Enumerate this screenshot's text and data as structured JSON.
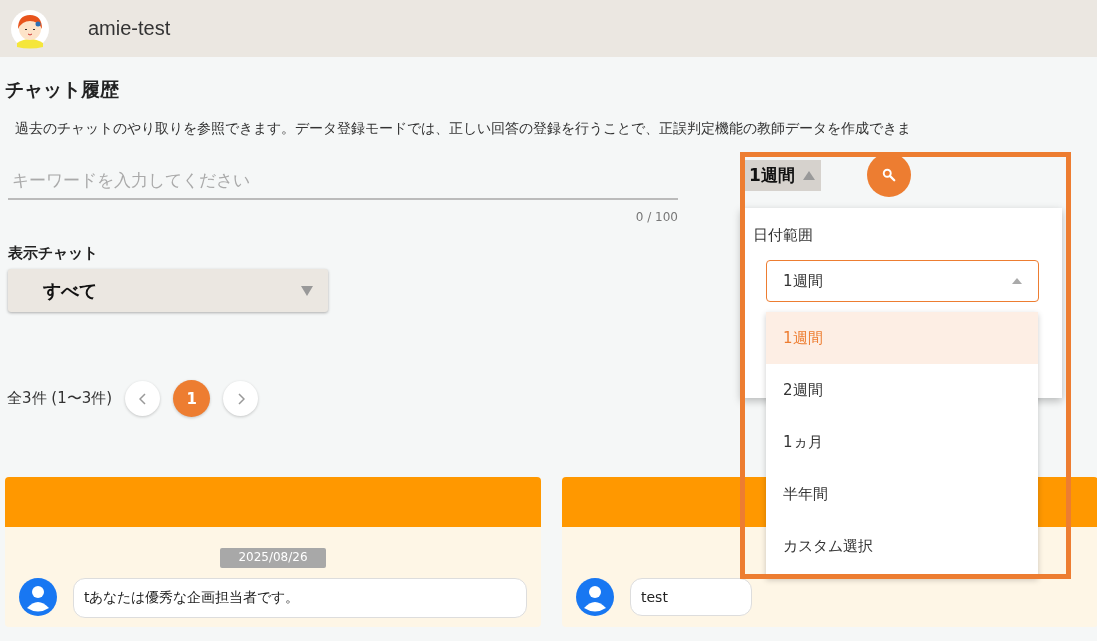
{
  "app": {
    "title": "amie-test"
  },
  "page": {
    "title": "チャット履歴",
    "description": "過去のチャットのやり取りを参照できます。データ登録モードでは、正しい回答の登録を行うことで、正誤判定機能の教師データを作成できま"
  },
  "search": {
    "placeholder": "キーワードを入力してください",
    "counter": "0 / 100"
  },
  "period_chip": {
    "label": "1週間",
    "expanded": true
  },
  "chat_filter": {
    "label": "表示チャット",
    "value": "すべて"
  },
  "pagination": {
    "summary": "全3件 (1〜3件)",
    "pages": [
      {
        "label": "1",
        "selected": true
      }
    ]
  },
  "date_popover": {
    "label": "日付範囲",
    "value": "1週間",
    "options": [
      {
        "label": "1週間",
        "selected": true
      },
      {
        "label": "2週間",
        "selected": false
      },
      {
        "label": "1ヵ月",
        "selected": false
      },
      {
        "label": "半年間",
        "selected": false
      },
      {
        "label": "カスタム選択",
        "selected": false
      }
    ]
  },
  "cards": [
    {
      "date": "2025/08/26",
      "message": "tあなたは優秀な企画担当者です。"
    },
    {
      "message": "test"
    }
  ]
}
